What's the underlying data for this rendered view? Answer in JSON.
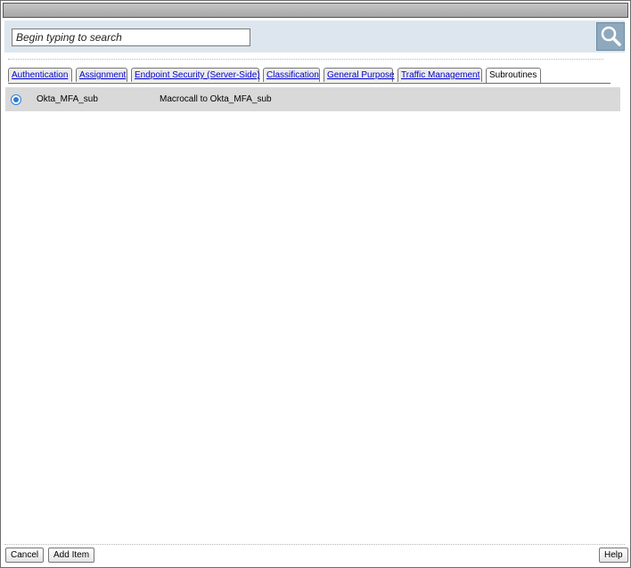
{
  "search": {
    "placeholder": "Begin typing to search",
    "button_icon": "magnifier-icon"
  },
  "tabs": [
    {
      "label": "Authentication",
      "active": false
    },
    {
      "label": "Assignment",
      "active": false
    },
    {
      "label": "Endpoint Security (Server-Side)",
      "active": false
    },
    {
      "label": "Classification",
      "active": false
    },
    {
      "label": "General Purpose",
      "active": false
    },
    {
      "label": "Traffic Management",
      "active": false
    },
    {
      "label": "Subroutines",
      "active": true
    }
  ],
  "items": [
    {
      "name": "Okta_MFA_sub",
      "description": "Macrocall to Okta_MFA_sub",
      "selected": true
    }
  ],
  "footer": {
    "cancel_label": "Cancel",
    "add_label": "Add Item",
    "help_label": "Help"
  },
  "colors": {
    "link": "#0000cc",
    "search_bar": "#dde6ee",
    "search_button": "#8ea9bd",
    "row_selected": "#d9d9d9",
    "radio": "#2b7bd6"
  }
}
